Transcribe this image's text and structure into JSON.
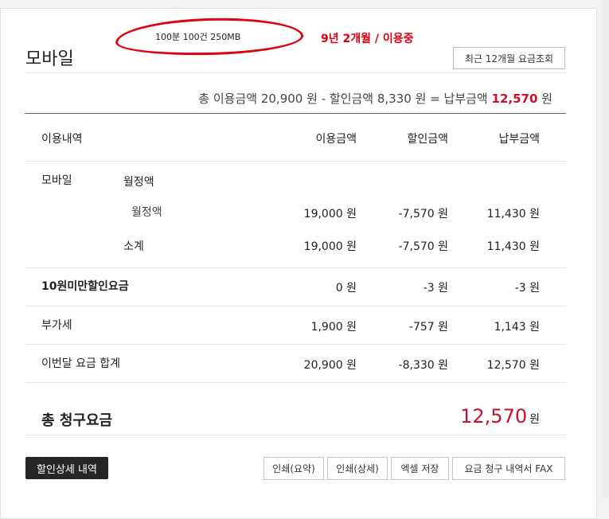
{
  "header": {
    "title": "모바일",
    "annotation_text": "100분 100건 250MB",
    "annotation_note": "9년 2개월 / 이용중",
    "recent_button": "최근 12개월 요금조회"
  },
  "summary": {
    "usage_label": "총 이용금액",
    "usage_value": "20,900 원",
    "minus": "-",
    "discount_label": "할인금액",
    "discount_value": "8,330 원",
    "equals": "=",
    "pay_label": "납부금액",
    "pay_value": "12,570",
    "pay_unit": "원"
  },
  "table": {
    "headers": [
      "이용내역",
      "이용금액",
      "할인금액",
      "납부금액"
    ],
    "mobile": {
      "group": "모바일",
      "subgroup": "월정액",
      "item_label": "월정액",
      "item": [
        "19,000 원",
        "-7,570 원",
        "11,430 원"
      ],
      "subtotal_label": "소계",
      "subtotal": [
        "19,000 원",
        "-7,570 원",
        "11,430 원"
      ]
    },
    "rows": [
      {
        "label": "10원미만할인요금",
        "values": [
          "0 원",
          "-3 원",
          "-3 원"
        ],
        "bold": true
      },
      {
        "label": "부가세",
        "values": [
          "1,900 원",
          "-757 원",
          "1,143 원"
        ],
        "bold": false
      },
      {
        "label": "이번달 요금 합계",
        "values": [
          "20,900 원",
          "-8,330 원",
          "12,570 원"
        ],
        "bold": false
      }
    ]
  },
  "total": {
    "label": "총 청구요금",
    "value": "12,570",
    "unit": "원"
  },
  "buttons": {
    "discount_detail": "할인상세 내역",
    "print_summary": "인쇄(요약)",
    "print_detail": "인쇄(상세)",
    "excel_save": "엑셀 저장",
    "fax": "요금 청구 내역서 FAX"
  },
  "colors": {
    "accent": "#c8102e",
    "annotation": "#e0000f",
    "dark_button": "#262626"
  }
}
